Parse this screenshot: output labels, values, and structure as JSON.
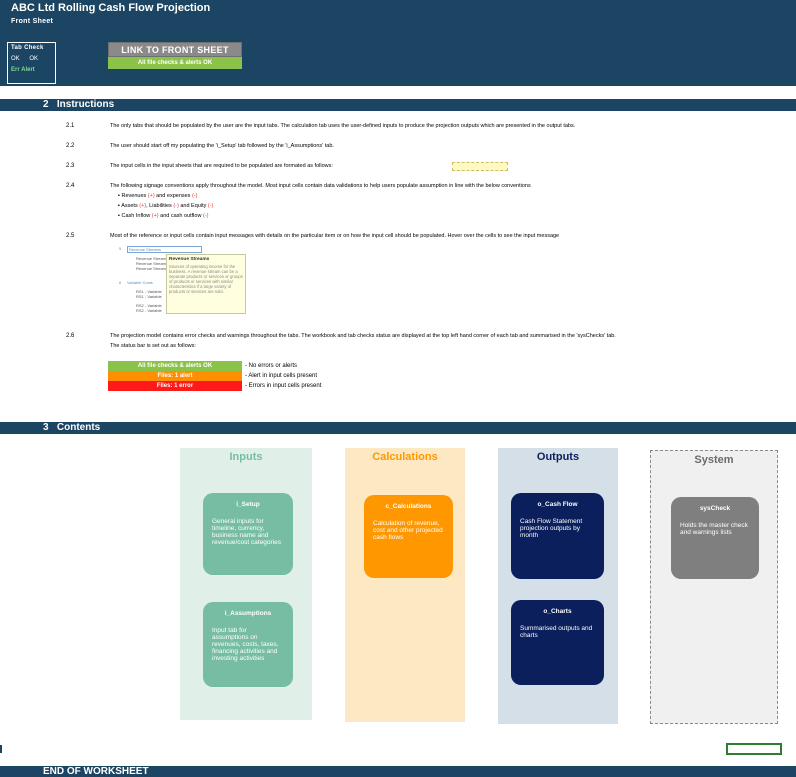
{
  "header": {
    "title": "ABC Ltd Rolling Cash Flow Projection",
    "subtitle": "Front Sheet"
  },
  "tab_check": {
    "title": "Tab Check",
    "ok_1": "OK",
    "ok_2": "OK",
    "err_alert": "Err Alert"
  },
  "link_button": "LINK TO FRONT SHEET",
  "status_ok": "All file checks & alerts OK",
  "section2": {
    "num": "2",
    "label": "Instructions"
  },
  "instructions": [
    {
      "num": "2.1",
      "text": "The only tabs that should be populated by the user are the input tabs. The calculation tab uses the user-defined inputs to produce the projection outputs which are presented in the output tabs."
    },
    {
      "num": "2.2",
      "text": "The user should start off my populating the 'i_Setup' tab followed by the 'i_Assumptions' tab."
    },
    {
      "num": "2.3",
      "text": "The input cells in the input sheets that are required to be populated are formated as follows:"
    },
    {
      "num": "2.4",
      "text": "The following signage conventions apply throughout the model. Most input cells contain data validations to help users populate assumption in line with the below conventions"
    },
    {
      "num": "2.5",
      "text": "Most of the reference or input cells contain input messages with details on the particular item or on how the input cell should be populated. Hover over the cells to see the input message"
    },
    {
      "num": "2.6",
      "text": "The projection model contains error checks and warnings throughout the tabs. The workbook and tab checks status are displayed at the top left hand corner of each tab and summarised in the 'sysChecks' tab."
    }
  ],
  "instruction_26_line2": "The status bar is set out as follows:",
  "sign_conventions": [
    {
      "pre": "Revenues ",
      "sign1": "(+)",
      "mid": " and expenses ",
      "sign2": "(-)",
      "mid2": "",
      "sign3": ""
    },
    {
      "pre": "Assets ",
      "sign1": "(+)",
      "mid": ", Liabilities ",
      "sign2": "(-)",
      "mid2": " and Equity ",
      "sign3": "(-)"
    },
    {
      "pre": "Cash Inflow ",
      "sign1": "(+)",
      "mid": " and cash outflow ",
      "sign2": "(-)",
      "mid2": "",
      "sign3": ""
    }
  ],
  "tooltip_sample": {
    "row_labels": [
      "Revenue Streams",
      "Revenue Stream",
      "Revenue Stream",
      "Revenue Stream",
      "Variable Costs",
      "RS1 - Variable",
      "RS1 - Variable",
      "RS2 - Variable",
      "RS2 - Variable"
    ],
    "head": "Revenue Streams",
    "body": "Sources of operating income for the business. A revenue stream can be a separate products or services or groups of products or services with similar characteristics if a large variety of products or services are sold."
  },
  "status_legend": [
    {
      "bar": "All file checks & alerts OK",
      "desc": "- No errors or alerts",
      "color": "#8bc34a"
    },
    {
      "bar": "Files: 1 alert",
      "desc": "- Alert in input cells present",
      "color": "#ff8f00"
    },
    {
      "bar": "Files: 1 error",
      "desc": "- Errors in input cells present",
      "color": "#ff1a1a"
    }
  ],
  "section3": {
    "num": "3",
    "label": "Contents"
  },
  "panels": {
    "inputs": {
      "title": "Inputs",
      "cards": [
        {
          "title": "i_Setup",
          "body": "General inputs for timeline, currency, business name and revenue/cost categories"
        },
        {
          "title": "i_Assumptions",
          "body": "Input tab for assumptions on revenues, costs, taxes, financing activities and investing activities"
        }
      ]
    },
    "calculations": {
      "title": "Calculations",
      "cards": [
        {
          "title": "c_Calculations",
          "body": "Calculation of revenue, cost and other projected cash flows"
        }
      ]
    },
    "outputs": {
      "title": "Outputs",
      "cards": [
        {
          "title": "o_Cash Flow",
          "body": "Cash Flow Statement projection outputs by month"
        },
        {
          "title": "o_Charts",
          "body": "Summarised outputs and charts"
        }
      ]
    },
    "system": {
      "title": "System",
      "cards": [
        {
          "title": "sysCheck",
          "body": "Holds the master check and warnings lists"
        }
      ]
    }
  },
  "end_label": "END OF WORKSHEET",
  "colors": {
    "navy": "#1c4563",
    "inputs_bg": "#e1efe9",
    "inputs_card": "#76bda3",
    "calc_bg": "#fce8c2",
    "calc_card": "#ff9800",
    "outputs_bg": "#d4dfe8",
    "outputs_card": "#0b1f5c",
    "system_bg": "#f0f0f0",
    "system_card": "#7f7f7f"
  }
}
